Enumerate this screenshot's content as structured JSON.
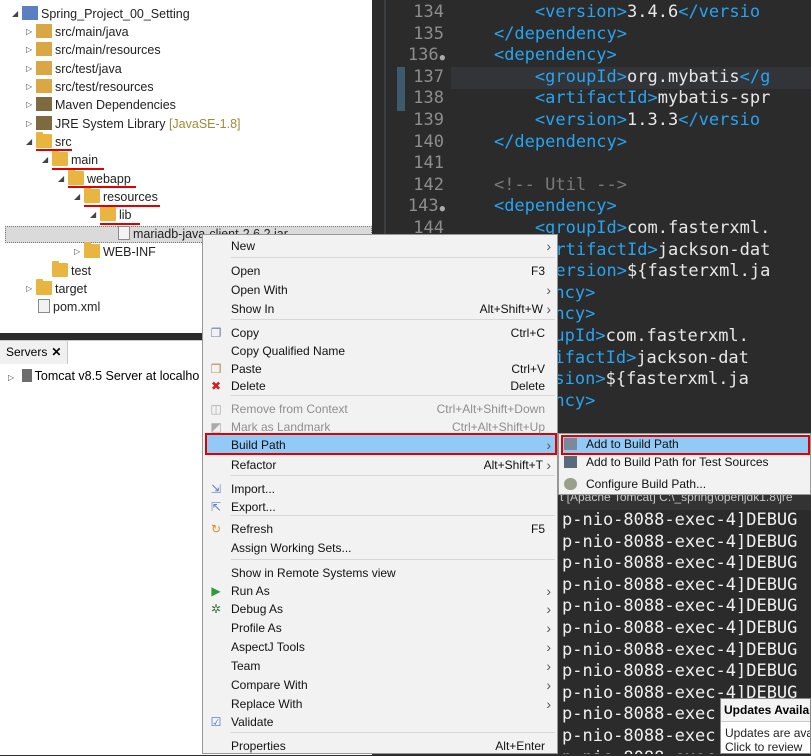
{
  "explorer": {
    "items": [
      {
        "label": "Spring_Project_00_Setting",
        "decoration": ""
      },
      {
        "label": "src/main/java",
        "decoration": ""
      },
      {
        "label": "src/main/resources",
        "decoration": ""
      },
      {
        "label": "src/test/java",
        "decoration": ""
      },
      {
        "label": "src/test/resources",
        "decoration": ""
      },
      {
        "label": "Maven Dependencies",
        "decoration": ""
      },
      {
        "label": "JRE System Library",
        "decoration": "[JavaSE-1.8]"
      },
      {
        "label": "src",
        "decoration": ""
      },
      {
        "label": "main",
        "decoration": ""
      },
      {
        "label": "webapp",
        "decoration": ""
      },
      {
        "label": "resources",
        "decoration": ""
      },
      {
        "label": "lib",
        "decoration": ""
      },
      {
        "label": "mariadb-java-client-2.6.2.jar",
        "decoration": ""
      },
      {
        "label": "WEB-INF",
        "decoration": ""
      },
      {
        "label": "test",
        "decoration": ""
      },
      {
        "label": "target",
        "decoration": ""
      },
      {
        "label": "pom.xml",
        "decoration": ""
      }
    ]
  },
  "servers": {
    "tab_label": "Servers",
    "close_glyph": "✕",
    "item": "Tomcat v8.5 Server at localho"
  },
  "editor": {
    "lines": [
      {
        "n": "134",
        "marker": ""
      },
      {
        "n": "135",
        "marker": ""
      },
      {
        "n": "136",
        "marker": "●"
      },
      {
        "n": "137",
        "marker": ""
      },
      {
        "n": "138",
        "marker": ""
      },
      {
        "n": "139",
        "marker": ""
      },
      {
        "n": "140",
        "marker": ""
      },
      {
        "n": "141",
        "marker": ""
      },
      {
        "n": "142",
        "marker": ""
      },
      {
        "n": "143",
        "marker": "●"
      },
      {
        "n": "144",
        "marker": ""
      }
    ],
    "code": [
      {
        "indent": "        ",
        "open": "<version>",
        "text": "3.4.6",
        "close": "</versio"
      },
      {
        "indent": "    ",
        "open": "</dependency>",
        "text": "",
        "close": ""
      },
      {
        "indent": "    ",
        "open": "<dependency>",
        "text": "",
        "close": ""
      },
      {
        "indent": "        ",
        "open": "<groupId>",
        "text": "org.mybatis",
        "close": "</g"
      },
      {
        "indent": "        ",
        "open": "<artifactId>",
        "text": "mybatis-spr",
        "close": ""
      },
      {
        "indent": "        ",
        "open": "<version>",
        "text": "1.3.3",
        "close": "</versio"
      },
      {
        "indent": "    ",
        "open": "</dependency>",
        "text": "",
        "close": ""
      },
      {
        "indent": "",
        "open": "",
        "text": "",
        "close": ""
      },
      {
        "indent": "    ",
        "open": "",
        "text": "<!-- Util -->",
        "close": ""
      },
      {
        "indent": "    ",
        "open": "<dependency>",
        "text": "",
        "close": ""
      },
      {
        "indent": "        ",
        "open": "<groupId>",
        "text": "com.fasterxml.",
        "close": ""
      },
      {
        "indent": "        ",
        "open": "<artifactId>",
        "text": "jackson-dat",
        "close": ""
      },
      {
        "indent": "        ",
        "open": "<version>",
        "text": "${fasterxml.ja",
        "close": ""
      },
      {
        "indent": "",
        "open": "ependency>",
        "text": "",
        "close": ""
      },
      {
        "indent": "",
        "open": "ependency>",
        "text": "",
        "close": ""
      },
      {
        "indent": "  ",
        "open": "<groupId>",
        "text": "com.fasterxml.",
        "close": ""
      },
      {
        "indent": "  ",
        "open": "<artifactId>",
        "text": "jackson-dat",
        "close": ""
      },
      {
        "indent": "  ",
        "open": "<version>",
        "text": "${fasterxml.ja",
        "close": ""
      },
      {
        "indent": "",
        "open": "ependency>",
        "text": "",
        "close": ""
      }
    ]
  },
  "console": {
    "header": "t [Apache Tomcat] C:\\_spring\\openjdk1.8\\jre",
    "lines": [
      "p-nio-8088-exec-4]DEBUG",
      "p-nio-8088-exec-4]DEBUG",
      "p-nio-8088-exec-4]DEBUG",
      "p-nio-8088-exec-4]DEBUG",
      "p-nio-8088-exec-4]DEBUG",
      "p-nio-8088-exec-4]DEBUG",
      "p-nio-8088-exec-4]DEBUG",
      "p-nio-8088-exec-4]DEBUG",
      "p-nio-8088-exec-4]DEBUG",
      "p-nio-8088-exec",
      "p-nio-8088-exec",
      "p-nio-8088-exec"
    ]
  },
  "updates_popup": {
    "title": "Updates Availab",
    "line1": "Updates are ava",
    "line2": "Click to review"
  },
  "context_menu": {
    "items": [
      {
        "label": "New",
        "shortcut": "",
        "submenu": true,
        "disabled": false,
        "icon": ""
      },
      {
        "label": "Open",
        "shortcut": "F3",
        "submenu": false,
        "disabled": false,
        "icon": ""
      },
      {
        "label": "Open With",
        "shortcut": "",
        "submenu": true,
        "disabled": false,
        "icon": ""
      },
      {
        "label": "Show In",
        "shortcut": "Alt+Shift+W",
        "submenu": true,
        "disabled": false,
        "icon": ""
      },
      {
        "label": "Copy",
        "shortcut": "Ctrl+C",
        "submenu": false,
        "disabled": false,
        "icon": "copy-icon"
      },
      {
        "label": "Copy Qualified Name",
        "shortcut": "",
        "submenu": false,
        "disabled": false,
        "icon": "copy-qualified-icon"
      },
      {
        "label": "Paste",
        "shortcut": "Ctrl+V",
        "submenu": false,
        "disabled": false,
        "icon": "paste-icon"
      },
      {
        "label": "Delete",
        "shortcut": "Delete",
        "submenu": false,
        "disabled": false,
        "icon": "delete-icon"
      },
      {
        "label": "Remove from Context",
        "shortcut": "Ctrl+Alt+Shift+Down",
        "submenu": false,
        "disabled": true,
        "icon": "remove-context-icon"
      },
      {
        "label": "Mark as Landmark",
        "shortcut": "Ctrl+Alt+Shift+Up",
        "submenu": false,
        "disabled": true,
        "icon": "landmark-icon"
      },
      {
        "label": "Build Path",
        "shortcut": "",
        "submenu": true,
        "disabled": false,
        "icon": ""
      },
      {
        "label": "Refactor",
        "shortcut": "Alt+Shift+T",
        "submenu": true,
        "disabled": false,
        "icon": ""
      },
      {
        "label": "Import...",
        "shortcut": "",
        "submenu": false,
        "disabled": false,
        "icon": "import-icon"
      },
      {
        "label": "Export...",
        "shortcut": "",
        "submenu": false,
        "disabled": false,
        "icon": "export-icon"
      },
      {
        "label": "Refresh",
        "shortcut": "F5",
        "submenu": false,
        "disabled": false,
        "icon": "refresh-icon"
      },
      {
        "label": "Assign Working Sets...",
        "shortcut": "",
        "submenu": false,
        "disabled": false,
        "icon": ""
      },
      {
        "label": "Show in Remote Systems view",
        "shortcut": "",
        "submenu": false,
        "disabled": false,
        "icon": ""
      },
      {
        "label": "Run As",
        "shortcut": "",
        "submenu": true,
        "disabled": false,
        "icon": "run-icon"
      },
      {
        "label": "Debug As",
        "shortcut": "",
        "submenu": true,
        "disabled": false,
        "icon": "debug-icon"
      },
      {
        "label": "Profile As",
        "shortcut": "",
        "submenu": true,
        "disabled": false,
        "icon": ""
      },
      {
        "label": "AspectJ Tools",
        "shortcut": "",
        "submenu": true,
        "disabled": false,
        "icon": ""
      },
      {
        "label": "Team",
        "shortcut": "",
        "submenu": true,
        "disabled": false,
        "icon": ""
      },
      {
        "label": "Compare With",
        "shortcut": "",
        "submenu": true,
        "disabled": false,
        "icon": ""
      },
      {
        "label": "Replace With",
        "shortcut": "",
        "submenu": true,
        "disabled": false,
        "icon": ""
      },
      {
        "label": "Validate",
        "shortcut": "",
        "submenu": false,
        "disabled": false,
        "icon": "checkbox-checked-icon"
      },
      {
        "label": "Properties",
        "shortcut": "Alt+Enter",
        "submenu": false,
        "disabled": false,
        "icon": ""
      }
    ]
  },
  "build_path_submenu": {
    "items": [
      {
        "label": "Add to Build Path",
        "icon": "add-build-path-icon"
      },
      {
        "label": "Add to Build Path for Test Sources",
        "icon": "add-test-build-path-icon"
      },
      {
        "label": "Configure Build Path...",
        "icon": "configure-build-path-icon"
      }
    ]
  },
  "colors": {
    "highlight": "#91c9f7",
    "annotation_red": "#e00000",
    "xml_tag": "#27a4f2",
    "editor_bg": "#2b2b2b"
  }
}
